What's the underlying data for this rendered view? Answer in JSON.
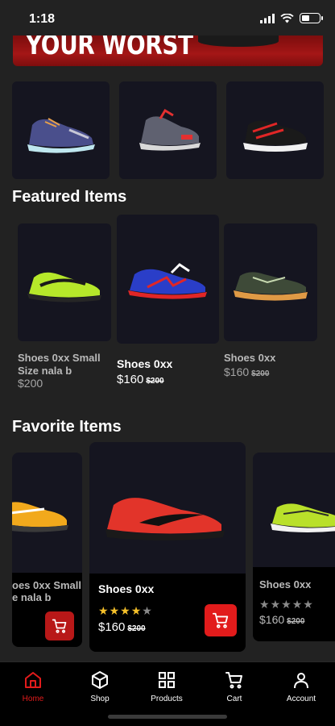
{
  "status": {
    "time": "1:18"
  },
  "banner": {
    "text": "YOUR WORST"
  },
  "featured": {
    "title": "Featured Items",
    "items": [
      {
        "name": "Shoes 0xx Small Size nala b",
        "price": "$200",
        "old_price": ""
      },
      {
        "name": "Shoes 0xx",
        "price": "$160",
        "old_price": "$200"
      },
      {
        "name": "Shoes 0xx",
        "price": "$160",
        "old_price": "$200"
      }
    ]
  },
  "favorite": {
    "title": "Favorite Items",
    "items": [
      {
        "name": "oes 0xx Small",
        "name2": "e nala b"
      },
      {
        "name": "Shoes 0xx",
        "rating": 4,
        "price": "$160",
        "old_price": "$200"
      },
      {
        "name": "Shoes 0xx",
        "rating": 0,
        "price": "$160",
        "old_price": "$200"
      }
    ]
  },
  "nav": {
    "items": [
      {
        "label": "Home",
        "icon": "home-icon",
        "active": true
      },
      {
        "label": "Shop",
        "icon": "box-icon"
      },
      {
        "label": "Products",
        "icon": "grid-icon"
      },
      {
        "label": "Cart",
        "icon": "cart-icon"
      },
      {
        "label": "Account",
        "icon": "user-icon"
      }
    ]
  },
  "colors": {
    "accent": "#e21b1b",
    "background": "#222222",
    "card": "#151520",
    "star": "#f5c02a"
  }
}
